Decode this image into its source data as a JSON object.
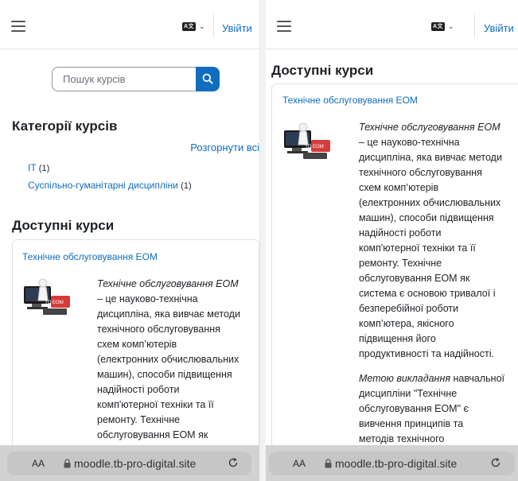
{
  "navbar": {
    "lang_code": "A文",
    "login_label": "Увійти"
  },
  "search": {
    "placeholder": "Пошук курсів"
  },
  "categories": {
    "title": "Категорії курсів",
    "expand_all": "Розгорнути всі",
    "items": [
      {
        "label": "IT",
        "count": "(1)"
      },
      {
        "label": "Суспільно-гуманітарні дисципліни",
        "count": "(1)"
      }
    ]
  },
  "available": {
    "title": "Доступні курси",
    "course_title": "Технічне обслуговування ЕОМ",
    "image_label": "ТО ЕОМ",
    "summary_lines_left": [
      "– це науково-технічна",
      "дисципліна, яка вивчає методи",
      "технічного обслуговування",
      "схем комп’ютерів",
      "(електронних обчислювальних",
      "машин), способи підвищення",
      "надійності роботи",
      "комп'ютерної техніки та її",
      "ремонту. Технічне",
      "обслуговування ЕОМ як"
    ],
    "summary_lines_right": [
      "– це науково-технічна",
      "дисципліна, яка вивчає методи",
      "технічного обслуговування",
      "схем комп’ютерів",
      "(електронних обчислювальних",
      "машин), способи підвищення",
      "надійності роботи",
      "комп'ютерної техніки та її",
      "ремонту. Технічне",
      "обслуговування ЕОМ як",
      "система є основою тривалої і",
      "безперебійної  роботи",
      "комп’ютера, якісного",
      "підвищення його",
      "продуктивності та надійності."
    ],
    "summary_italic": "Технічне обслуговування ЕОМ",
    "goal_italic": "Метою викладання",
    "goal_rest_first": " навчальної",
    "goal_lines": [
      "дисципліни \"Технічне",
      "обслуговування ЕОМ\" є",
      "вивчення  принципів та",
      "методів технічного"
    ]
  },
  "browser": {
    "aa_label": "AA",
    "url": "moodle.tb-pro-digital.site"
  }
}
